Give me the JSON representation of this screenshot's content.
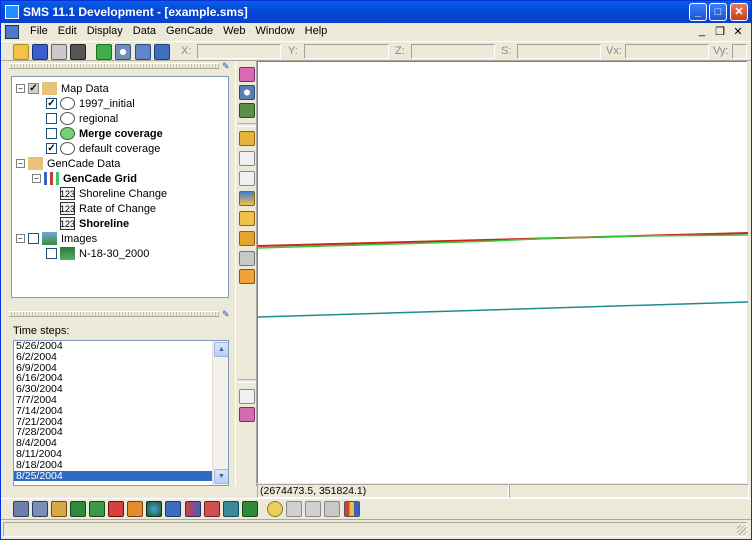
{
  "window": {
    "title": "SMS 11.1 Development - [example.sms]",
    "min": "_",
    "max": "□",
    "close": "✕"
  },
  "menu": {
    "items": [
      "File",
      "Edit",
      "Display",
      "Data",
      "GenCade",
      "Web",
      "Window",
      "Help"
    ],
    "mdi_min": "_",
    "mdi_restore": "❐",
    "mdi_close": "✕"
  },
  "toolbar": {
    "buttons": [
      "open-icon",
      "save-icon",
      "print-icon",
      "delete-icon",
      "refresh-icon",
      "zoom-icon",
      "info-icon",
      "python-icon"
    ],
    "coords": [
      {
        "label": "X:",
        "value": ""
      },
      {
        "label": "Y:",
        "value": ""
      },
      {
        "label": "Z:",
        "value": ""
      },
      {
        "label": "S:",
        "value": ""
      },
      {
        "label": "Vx:",
        "value": ""
      },
      {
        "label": "Vy:",
        "value": ""
      }
    ]
  },
  "tree": {
    "map_data": "Map Data",
    "cov_1997": "1997_initial",
    "cov_regional": "regional",
    "cov_merge": "Merge coverage",
    "cov_default": "default coverage",
    "gencade_data": "GenCade Data",
    "gencade_grid": "GenCade Grid",
    "ds_shoreline_change": "Shoreline Change",
    "ds_rate_of_change": "Rate of Change",
    "ds_shoreline": "Shoreline",
    "images": "Images",
    "image_1": "N-18-30_2000",
    "dataset_badge": "123"
  },
  "timesteps": {
    "label": "Time steps:",
    "items": [
      "5/26/2004",
      "6/2/2004",
      "6/9/2004",
      "6/16/2004",
      "6/30/2004",
      "7/7/2004",
      "7/14/2004",
      "7/21/2004",
      "7/28/2004",
      "8/4/2004",
      "8/11/2004",
      "8/18/2004",
      "8/25/2004"
    ],
    "selected": "8/25/2004"
  },
  "canvas": {
    "lines": [
      {
        "name": "red",
        "color": "#d42020"
      },
      {
        "name": "green",
        "color": "#33cc33"
      },
      {
        "name": "teal",
        "color": "#1f8c8c"
      }
    ]
  },
  "status": {
    "coordinates": "(2674473.5, 351824.1)"
  },
  "colors": {
    "accent": "#0a5ee8",
    "selection": "#316ac5"
  }
}
